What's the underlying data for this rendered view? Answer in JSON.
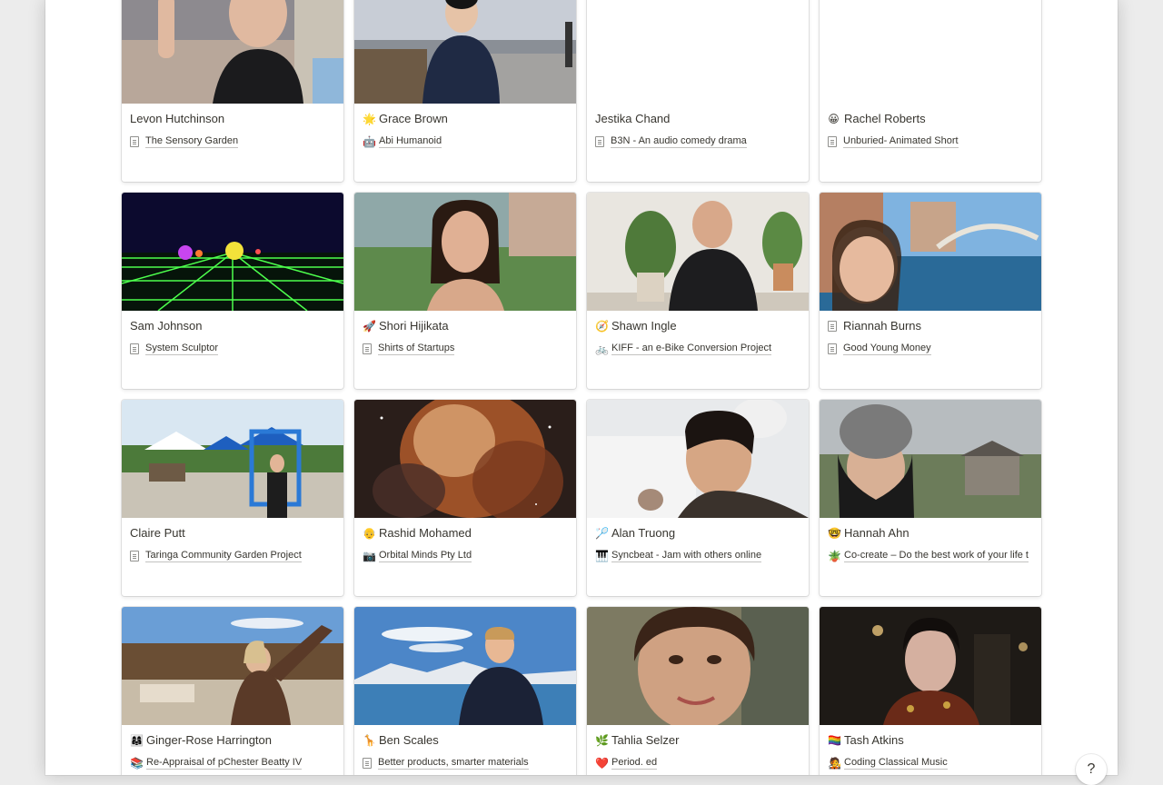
{
  "cards": [
    {
      "name": "Levon Hutchinson",
      "name_emoji": "",
      "project": "The Sensory Garden",
      "project_icon": "doc",
      "cover": "photo-person-peace-sign"
    },
    {
      "name": "Grace Brown",
      "name_emoji": "🌟",
      "project": "Abi Humanoid",
      "project_icon": "🤖",
      "cover": "photo-person-pier"
    },
    {
      "name": "Jestika Chand",
      "name_emoji": "",
      "project": "B3N - An audio comedy drama",
      "project_icon": "doc",
      "cover": "none"
    },
    {
      "name": "Rachel Roberts",
      "name_emoji": "😀",
      "project": "Unburied- Animated Short",
      "project_icon": "doc",
      "cover": "none"
    },
    {
      "name": "Sam Johnson",
      "name_emoji": "",
      "project": "System Sculptor",
      "project_icon": "doc",
      "cover": "synthwave-grid"
    },
    {
      "name": "Shori Hijikata",
      "name_emoji": "🚀",
      "project": "Shirts of Startups",
      "project_icon": "page",
      "cover": "photo-person-city"
    },
    {
      "name": "Shawn Ingle",
      "name_emoji": "🧭",
      "project": "KIFF - an e-Bike Conversion Project",
      "project_icon": "🚲",
      "cover": "photo-person-office"
    },
    {
      "name": "Riannah Burns",
      "name_emoji": "",
      "project": "Good Young Money",
      "project_icon": "doc",
      "cover": "photo-person-venice",
      "name_icon": "doc"
    },
    {
      "name": "Claire Putt",
      "name_emoji": "",
      "project": "Taringa Community Garden Project",
      "project_icon": "doc",
      "cover": "photo-garden-market"
    },
    {
      "name": "Rashid Mohamed",
      "name_emoji": "👴",
      "project": "Orbital Minds Pty Ltd",
      "project_icon": "📷",
      "cover": "photo-nebula"
    },
    {
      "name": "Alan Truong",
      "name_emoji": "🏸",
      "project": "Syncbeat - Jam with others online",
      "project_icon": "🎹",
      "cover": "photo-person-snow"
    },
    {
      "name": "Hannah Ahn",
      "name_emoji": "🤓",
      "project": "Co-create – Do the best work of your life t",
      "project_icon": "🪴",
      "cover": "photo-person-beanie"
    },
    {
      "name": "Ginger-Rose Harrington",
      "name_emoji": "👩‍👩‍👧",
      "project": "Re-Appraisal of pChester Beatty IV",
      "project_icon": "📚",
      "cover": "photo-person-canyon"
    },
    {
      "name": "Ben Scales",
      "name_emoji": "🦒",
      "project": "Better products, smarter materials",
      "project_icon": "page",
      "cover": "photo-person-lake"
    },
    {
      "name": "Tahlia Selzer",
      "name_emoji": "🌿",
      "project": "Period. ed",
      "project_icon": "❤️",
      "cover": "photo-person-closeup"
    },
    {
      "name": "Tash Atkins",
      "name_emoji": "🏳️‍🌈",
      "project": "Coding Classical Music",
      "project_icon": "🧑‍🎤",
      "cover": "photo-person-dark-hall"
    }
  ],
  "help": {
    "label": "?"
  }
}
